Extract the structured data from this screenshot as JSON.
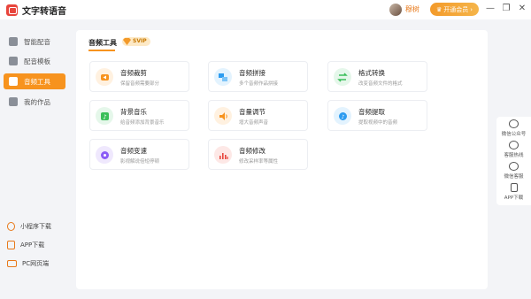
{
  "app": {
    "title": "文字转语音",
    "username": "穆树",
    "vip_button": "开通会员"
  },
  "sidebar": {
    "items": [
      {
        "label": "智能配音",
        "icon": "microphone-icon",
        "active": false
      },
      {
        "label": "配音模板",
        "icon": "template-icon",
        "active": false
      },
      {
        "label": "音频工具",
        "icon": "audio-tools-icon",
        "active": true
      },
      {
        "label": "我的作品",
        "icon": "folder-icon",
        "active": false
      }
    ],
    "footer": [
      {
        "label": "小程序下载",
        "icon": "mini-program-icon"
      },
      {
        "label": "APP下载",
        "icon": "phone-icon"
      },
      {
        "label": "PC网页端",
        "icon": "monitor-icon"
      }
    ]
  },
  "main": {
    "title": "音频工具",
    "badge": "SVIP",
    "tools": [
      {
        "name": "音频裁剪",
        "desc": "保留音频需要部分",
        "icon": "scissors-icon",
        "color": "#f7931e",
        "bg": "#fff1e0"
      },
      {
        "name": "音频拼接",
        "desc": "多个音频作品拼接",
        "icon": "merge-icon",
        "color": "#2d9cf0",
        "bg": "#e3f3fe"
      },
      {
        "name": "格式转换",
        "desc": "改变音频文件的格式",
        "icon": "convert-icon",
        "color": "#3bbf5a",
        "bg": "#e5f7ea"
      },
      {
        "name": "背景音乐",
        "desc": "给音频添加背景音乐",
        "icon": "music-icon",
        "color": "#3bbf5a",
        "bg": "#e5f7ea"
      },
      {
        "name": "音量调节",
        "desc": "增大音频声音",
        "icon": "volume-icon",
        "color": "#f7931e",
        "bg": "#fff1e0"
      },
      {
        "name": "音频提取",
        "desc": "提取视频中的音频",
        "icon": "extract-icon",
        "color": "#2d9cf0",
        "bg": "#e3f3fe"
      },
      {
        "name": "音频变速",
        "desc": "影视解说倍短停顿",
        "icon": "speed-icon",
        "color": "#8b5cf6",
        "bg": "#efe8fd"
      },
      {
        "name": "音频修改",
        "desc": "修改采样率等属性",
        "icon": "edit-audio-icon",
        "color": "#e8453c",
        "bg": "#fde8e6"
      }
    ]
  },
  "rightbar": {
    "items": [
      {
        "label": "微信公众号",
        "icon": "wechat-icon"
      },
      {
        "label": "客服热线",
        "icon": "hotline-icon"
      },
      {
        "label": "微信客服",
        "icon": "wechat-service-icon"
      },
      {
        "label": "APP下载",
        "icon": "phone-icon"
      }
    ]
  }
}
